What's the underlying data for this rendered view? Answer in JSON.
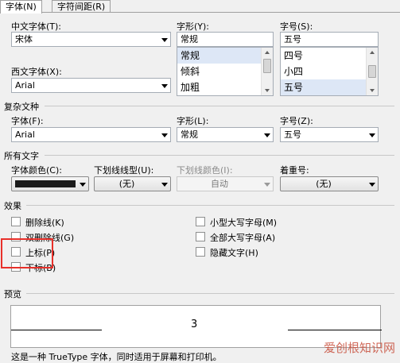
{
  "tabs": [
    {
      "label": "字体(N)",
      "active": true
    },
    {
      "label": "字符间距(R)",
      "active": false
    }
  ],
  "font_cn": {
    "label": "中文字体(T):",
    "value": "宋体"
  },
  "style": {
    "label": "字形(Y):",
    "value": "常规",
    "options": [
      "常规",
      "倾斜",
      "加粗"
    ],
    "selected": "常规"
  },
  "size": {
    "label": "字号(S):",
    "value": "五号",
    "options": [
      "四号",
      "小四",
      "五号"
    ],
    "selected": "五号"
  },
  "font_west": {
    "label": "西文字体(X):",
    "value": "Arial"
  },
  "complex": {
    "section": "复杂文种",
    "font_label": "字体(F):",
    "font_value": "Arial",
    "style_label": "字形(L):",
    "style_value": "常规",
    "size_label": "字号(Z):",
    "size_value": "五号"
  },
  "all_text": {
    "section": "所有文字",
    "color_label": "字体颜色(C):",
    "color_value": "#1a1a1a",
    "underline_label": "下划线线型(U):",
    "underline_value": "(无)",
    "underline_color_label": "下划线颜色(I):",
    "underline_color_value": "自动",
    "emphasis_label": "着重号:",
    "emphasis_value": "(无)"
  },
  "effects": {
    "section": "效果",
    "left": [
      {
        "label": "删除线(K)",
        "checked": false
      },
      {
        "label": "双删除线(G)",
        "checked": false
      },
      {
        "label": "上标(P)",
        "checked": false
      },
      {
        "label": "下标(B)",
        "checked": false
      }
    ],
    "right": [
      {
        "label": "小型大写字母(M)",
        "checked": false
      },
      {
        "label": "全部大写字母(A)",
        "checked": false
      },
      {
        "label": "隐藏文字(H)",
        "checked": false
      }
    ]
  },
  "preview": {
    "section": "预览",
    "sample": "3",
    "note": "这是一种 TrueType 字体，同时适用于屏幕和打印机。"
  },
  "watermark": "爱创根知识网",
  "highlight_color": "#e8302a"
}
